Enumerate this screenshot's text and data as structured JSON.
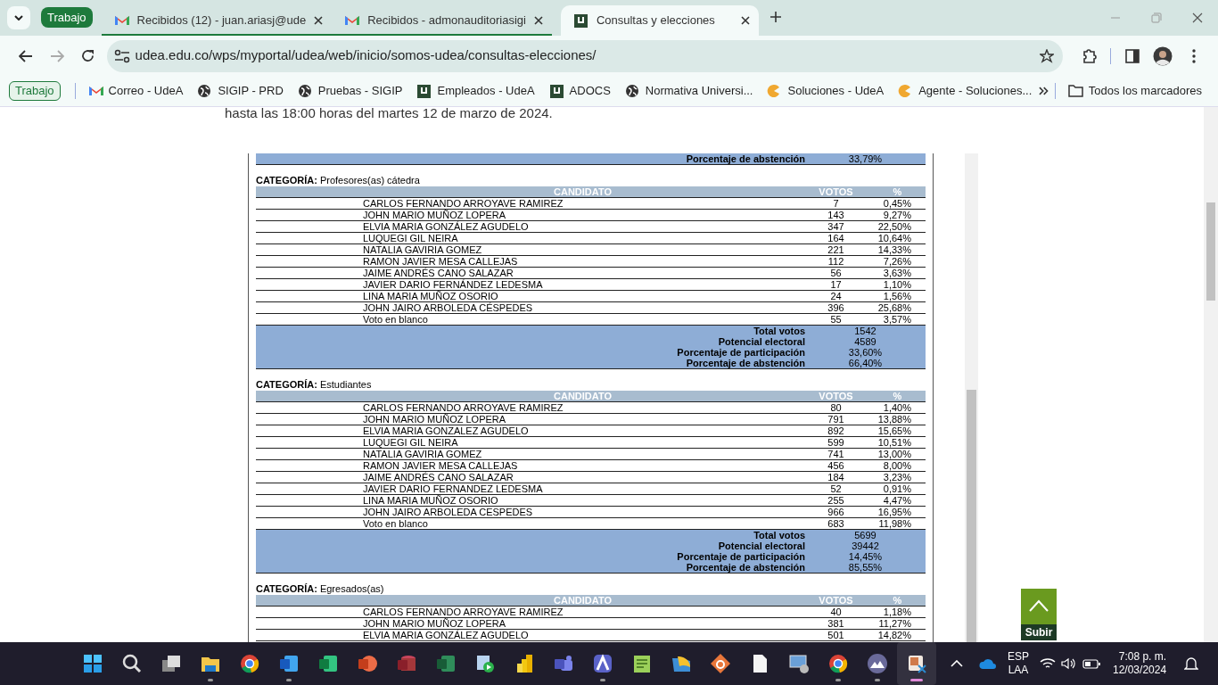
{
  "tab_group": {
    "label": "Trabajo",
    "tabs": [
      {
        "title": "Recibidos (12) - juan.ariasj@ude",
        "kind": "mail",
        "selected": false
      },
      {
        "title": "Recibidos - admonauditoriasigi",
        "kind": "mail",
        "selected": false
      }
    ]
  },
  "tabs": [
    {
      "title": "Consultas y elecciones",
      "kind": "site",
      "selected": true
    }
  ],
  "address_bar": {
    "url": "udea.edu.co/wps/myportal/udea/web/inicio/somos-udea/consultas-elecciones/"
  },
  "bookmarks": [
    {
      "label": "Trabajo",
      "kind": "group"
    },
    {
      "label": "Correo - UdeA",
      "kind": "mail"
    },
    {
      "label": "SIGIP - PRD",
      "kind": "globe"
    },
    {
      "label": "Pruebas - SIGIP",
      "kind": "globe"
    },
    {
      "label": "Empleados - UdeA",
      "kind": "site"
    },
    {
      "label": "ADOCS",
      "kind": "site"
    },
    {
      "label": "Normativa Universi...",
      "kind": "globe"
    },
    {
      "label": "Soluciones - UdeA",
      "kind": "pac"
    },
    {
      "label": "Agente - Soluciones...",
      "kind": "pac"
    }
  ],
  "all_bookmarks": "Todos los marcadores",
  "page": {
    "intro": "hasta las 18:00 horas del martes 12 de marzo de 2024.",
    "previous_summary": {
      "label": "Porcentaje de abstención",
      "value": "33,79%"
    },
    "categories": [
      {
        "label": "CATEGORÍA:",
        "name": "Profesores(as) cátedra",
        "columns": [
          "CANDIDATO",
          "VOTOS",
          "%"
        ],
        "rows": [
          {
            "candidate": "CARLOS FERNANDO ARROYAVE RAMIREZ",
            "votes": "7",
            "percent": "0,45%"
          },
          {
            "candidate": "JOHN MARIO MUÑOZ LOPERA",
            "votes": "143",
            "percent": "9,27%"
          },
          {
            "candidate": "ELVIA MARIA GONZÁLEZ AGUDELO",
            "votes": "347",
            "percent": "22,50%"
          },
          {
            "candidate": "LUQUEGI GIL NEIRA",
            "votes": "164",
            "percent": "10,64%"
          },
          {
            "candidate": "NATALIA GAVIRIA GOMEZ",
            "votes": "221",
            "percent": "14,33%"
          },
          {
            "candidate": "RAMON JAVIER MESA CALLEJAS",
            "votes": "112",
            "percent": "7,26%"
          },
          {
            "candidate": "JAIME ANDRÉS CANO SALAZAR",
            "votes": "56",
            "percent": "3,63%"
          },
          {
            "candidate": "JAVIER DARIO FERNÁNDEZ LEDESMA",
            "votes": "17",
            "percent": "1,10%"
          },
          {
            "candidate": "LINA MARIA MUÑOZ OSORIO",
            "votes": "24",
            "percent": "1,56%"
          },
          {
            "candidate": "JOHN JAIRO ARBOLEDA CÉSPEDES",
            "votes": "396",
            "percent": "25,68%"
          },
          {
            "candidate": "Voto en blanco",
            "votes": "55",
            "percent": "3,57%"
          }
        ],
        "summary": [
          {
            "label": "Total votos",
            "value": "1542"
          },
          {
            "label": "Potencial electoral",
            "value": "4589"
          },
          {
            "label": "Porcentaje de participación",
            "value": "33,60%"
          },
          {
            "label": "Porcentaje de abstención",
            "value": "66,40%"
          }
        ]
      },
      {
        "label": "CATEGORÍA:",
        "name": "Estudiantes",
        "columns": [
          "CANDIDATO",
          "VOTOS",
          "%"
        ],
        "rows": [
          {
            "candidate": "CARLOS FERNANDO ARROYAVE RAMIREZ",
            "votes": "80",
            "percent": "1,40%"
          },
          {
            "candidate": "JOHN MARIO MUÑOZ LOPERA",
            "votes": "791",
            "percent": "13,88%"
          },
          {
            "candidate": "ELVIA MARIA GONZALEZ AGUDELO",
            "votes": "892",
            "percent": "15,65%"
          },
          {
            "candidate": "LUQUEGI GIL NEIRA",
            "votes": "599",
            "percent": "10,51%"
          },
          {
            "candidate": "NATALIA GAVIRIA GOMEZ",
            "votes": "741",
            "percent": "13,00%"
          },
          {
            "candidate": "RAMON JAVIER MESA CALLEJAS",
            "votes": "456",
            "percent": "8,00%"
          },
          {
            "candidate": "JAIME ANDRÉS CANO SALAZAR",
            "votes": "184",
            "percent": "3,23%"
          },
          {
            "candidate": "JAVIER DARIO FERNANDEZ LEDESMA",
            "votes": "52",
            "percent": "0,91%"
          },
          {
            "candidate": "LINA MARIA MUÑOZ OSORIO",
            "votes": "255",
            "percent": "4,47%"
          },
          {
            "candidate": "JOHN JAIRO ARBOLEDA CESPEDES",
            "votes": "966",
            "percent": "16,95%"
          },
          {
            "candidate": "Voto en blanco",
            "votes": "683",
            "percent": "11,98%"
          }
        ],
        "summary": [
          {
            "label": "Total votos",
            "value": "5699"
          },
          {
            "label": "Potencial electoral",
            "value": "39442"
          },
          {
            "label": "Porcentaje de participación",
            "value": "14,45%"
          },
          {
            "label": "Porcentaje de abstención",
            "value": "85,55%"
          }
        ]
      },
      {
        "label": "CATEGORÍA:",
        "name": "Egresados(as)",
        "columns": [
          "CANDIDATO",
          "VOTOS",
          "%"
        ],
        "rows": [
          {
            "candidate": "CARLOS FERNANDO ARROYAVE RAMIREZ",
            "votes": "40",
            "percent": "1,18%"
          },
          {
            "candidate": "JOHN MARIO MUÑOZ LOPERA",
            "votes": "381",
            "percent": "11,27%"
          },
          {
            "candidate": "ELVIA MARIA GONZÁLEZ AGUDELO",
            "votes": "501",
            "percent": "14,82%"
          }
        ]
      }
    ]
  },
  "scroll_top_button": {
    "label": "Subir"
  },
  "taskbar": {
    "apps": [
      {
        "kind": "start",
        "running": false,
        "selected": false
      },
      {
        "kind": "search",
        "running": false,
        "selected": false
      },
      {
        "kind": "taskview",
        "running": false,
        "selected": false
      },
      {
        "kind": "explorer",
        "running": true,
        "selected": false
      },
      {
        "kind": "chrome",
        "running": false,
        "selected": false
      },
      {
        "kind": "word",
        "running": true,
        "selected": false
      },
      {
        "kind": "excel",
        "running": false,
        "selected": false
      },
      {
        "kind": "powerpoint",
        "running": false,
        "selected": false
      },
      {
        "kind": "access",
        "running": false,
        "selected": false
      },
      {
        "kind": "project",
        "running": false,
        "selected": false
      },
      {
        "kind": "video",
        "running": false,
        "selected": false
      },
      {
        "kind": "powerbi",
        "running": false,
        "selected": false
      },
      {
        "kind": "teams",
        "running": false,
        "selected": false
      },
      {
        "kind": "aapp",
        "running": true,
        "selected": false
      },
      {
        "kind": "notepad",
        "running": false,
        "selected": false
      },
      {
        "kind": "folderapp",
        "running": false,
        "selected": false
      },
      {
        "kind": "bapp",
        "running": false,
        "selected": false
      },
      {
        "kind": "file",
        "running": false,
        "selected": false
      },
      {
        "kind": "remote",
        "running": false,
        "selected": false
      },
      {
        "kind": "chrome",
        "running": true,
        "selected": false
      },
      {
        "kind": "mountain",
        "running": true,
        "selected": false
      },
      {
        "kind": "snip",
        "running": true,
        "selected": true
      }
    ],
    "language": "ESP",
    "layout": "LAA",
    "time": "7:08 p. m.",
    "date": "12/03/2024"
  }
}
